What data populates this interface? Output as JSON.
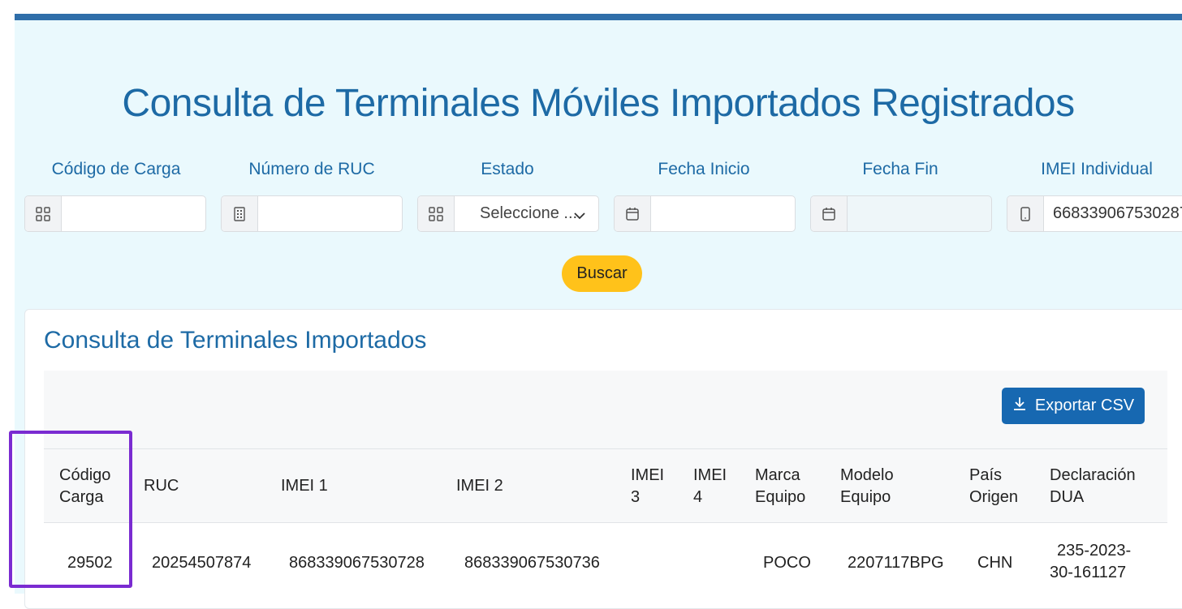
{
  "page_title": "Consulta de Terminales Móviles Importados Registrados",
  "filters": {
    "codigo_carga": {
      "label": "Código de Carga",
      "value": ""
    },
    "numero_ruc": {
      "label": "Número de RUC",
      "value": ""
    },
    "estado": {
      "label": "Estado",
      "selected": "Seleccione ..."
    },
    "fecha_inicio": {
      "label": "Fecha Inicio",
      "value": ""
    },
    "fecha_fin": {
      "label": "Fecha Fin",
      "value": ""
    },
    "imei_individual": {
      "label": "IMEI Individual",
      "value": "668339067530287"
    }
  },
  "search_button": "Buscar",
  "results": {
    "title": "Consulta de Terminales Importados",
    "export_button": "Exportar CSV",
    "columns": [
      {
        "line1": "Código",
        "line2": "Carga"
      },
      {
        "line1": "RUC",
        "line2": ""
      },
      {
        "line1": "IMEI 1",
        "line2": ""
      },
      {
        "line1": "IMEI 2",
        "line2": ""
      },
      {
        "line1": "IMEI",
        "line2": "3"
      },
      {
        "line1": "IMEI",
        "line2": "4"
      },
      {
        "line1": "Marca",
        "line2": "Equipo"
      },
      {
        "line1": "Modelo",
        "line2": "Equipo"
      },
      {
        "line1": "País",
        "line2": "Origen"
      },
      {
        "line1": "Declaración",
        "line2": "DUA"
      }
    ],
    "rows": [
      {
        "codigo_carga": "29502",
        "ruc": "20254507874",
        "imei1": "868339067530728",
        "imei2": "868339067530736",
        "imei3": "",
        "imei4": "",
        "marca": "POCO",
        "modelo": "2207117BPG",
        "pais": "CHN",
        "dua_line1": "235-2023-",
        "dua_line2": "30-161127"
      }
    ]
  },
  "colors": {
    "primary": "#1d6aa5",
    "accent": "#ffc21a",
    "highlight": "#7a2bd1"
  }
}
